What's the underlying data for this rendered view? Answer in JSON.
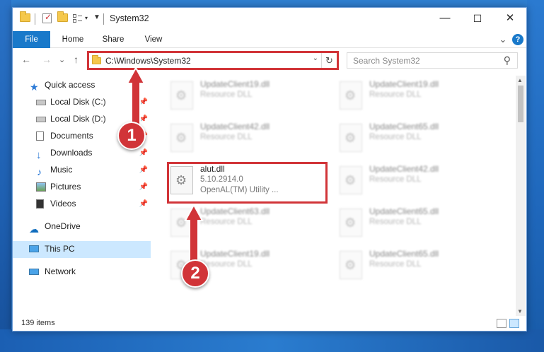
{
  "window": {
    "title": "System32",
    "minimize": "—",
    "maximize": "☐",
    "close": "✕"
  },
  "ribbon": {
    "tabs": [
      "File",
      "Home",
      "Share",
      "View"
    ],
    "expand": "⌄",
    "help": "?"
  },
  "navigation": {
    "back": "←",
    "forward": "→",
    "recent": "⌄",
    "up": "↑"
  },
  "address": {
    "path": "C:\\Windows\\System32",
    "dropdown": "⌄",
    "refresh": "↻"
  },
  "search": {
    "placeholder": "Search System32",
    "icon": "search-icon"
  },
  "sidebar": {
    "items": [
      {
        "label": "Quick access",
        "icon": "star-icon",
        "pinned": false
      },
      {
        "label": "Local Disk (C:)",
        "icon": "drive-icon",
        "pinned": true
      },
      {
        "label": "Local Disk (D:)",
        "icon": "drive-icon",
        "pinned": true
      },
      {
        "label": "Documents",
        "icon": "documents-icon",
        "pinned": true
      },
      {
        "label": "Downloads",
        "icon": "download-icon",
        "pinned": true
      },
      {
        "label": "Music",
        "icon": "music-icon",
        "pinned": true
      },
      {
        "label": "Pictures",
        "icon": "pictures-icon",
        "pinned": true
      },
      {
        "label": "Videos",
        "icon": "videos-icon",
        "pinned": true
      },
      {
        "label": "OneDrive",
        "icon": "cloud-icon",
        "pinned": false
      },
      {
        "label": "This PC",
        "icon": "computer-icon",
        "pinned": false,
        "selected": true
      },
      {
        "label": "Network",
        "icon": "network-icon",
        "pinned": false
      }
    ],
    "pin_glyph": "📌"
  },
  "files": [
    {
      "name": "UpdateClient19.dll",
      "type": "Resource DLL",
      "blurred": true
    },
    {
      "name": "UpdateClient19.dll",
      "type": "Resource DLL",
      "blurred": true
    },
    {
      "name": "UpdateClient42.dll",
      "type": "Resource DLL",
      "blurred": true
    },
    {
      "name": "UpdateClient65.dll",
      "type": "Resource DLL",
      "blurred": true
    },
    {
      "name": "alut.dll",
      "version": "5.10.2914.0",
      "type": "OpenAL(TM) Utility ...",
      "blurred": false
    },
    {
      "name": "UpdateClient42.dll",
      "type": "Resource DLL",
      "blurred": true
    },
    {
      "name": "UpdateClient63.dll",
      "type": "Resource DLL",
      "blurred": true
    },
    {
      "name": "UpdateClient65.dll",
      "type": "Resource DLL",
      "blurred": true
    },
    {
      "name": "UpdateClient19.dll",
      "type": "Resource DLL",
      "blurred": true
    },
    {
      "name": "UpdateClient65.dll",
      "type": "Resource DLL",
      "blurred": true
    }
  ],
  "status": {
    "item_count": "139 items"
  },
  "annotations": {
    "step1": "1",
    "step2": "2",
    "color": "#d13438"
  }
}
